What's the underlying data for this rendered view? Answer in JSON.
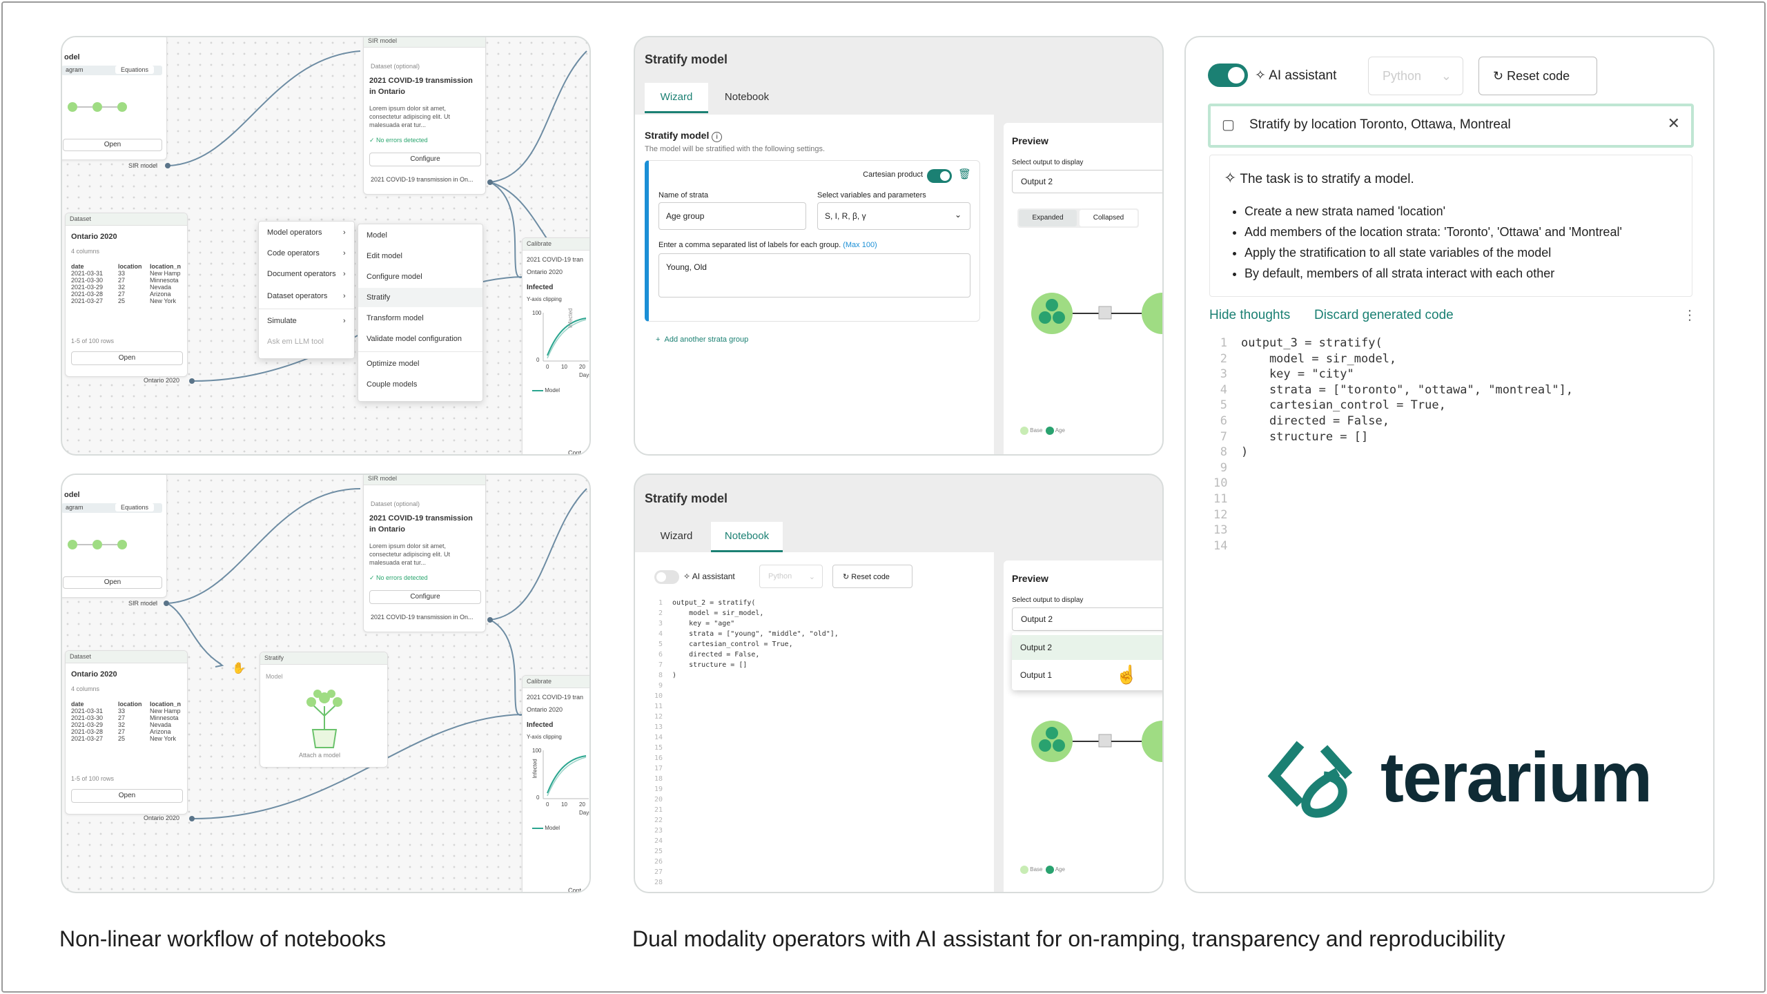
{
  "panel1": {
    "model_node": {
      "title": "odel",
      "tabs": [
        "agram",
        "Equations"
      ],
      "open": "Open",
      "port": "SIR model"
    },
    "sir_node": {
      "header": "SIR model",
      "dataset_opt": "Dataset (optional)",
      "title": "2021 COVID-19 transmission in Ontario",
      "body": "Lorem ipsum dolor sit amet, consectetur adipiscing elit. Ut malesuada erat tur...",
      "status": "No errors detected",
      "configure": "Configure",
      "port": "2021 COVID-19 transmission in On..."
    },
    "dataset_node": {
      "header": "Dataset",
      "title": "Ontario 2020",
      "columns": "4 columns",
      "table_headers": [
        "date",
        "location",
        "location_n"
      ],
      "rows": [
        [
          "2021-03-31",
          "33",
          "New Hamp"
        ],
        [
          "2021-03-30",
          "27",
          "Minnesota"
        ],
        [
          "2021-03-29",
          "32",
          "Nevada"
        ],
        [
          "2021-03-28",
          "27",
          "Arizona"
        ],
        [
          "2021-03-27",
          "25",
          "New York"
        ]
      ],
      "rows_info": "1-5 of 100 rows",
      "open": "Open",
      "port": "Ontario 2020"
    },
    "context_menu": [
      "Model operators",
      "Code operators",
      "Document operators",
      "Dataset operators",
      "Simulate",
      "Ask em LLM tool"
    ],
    "submenu": [
      "Model",
      "Edit model",
      "Configure model",
      "Stratify",
      "Transform model",
      "Validate model configuration",
      "Optimize model",
      "Couple models"
    ],
    "calibrate_node": {
      "header": "Calibrate",
      "in1": "2021 COVID-19 tran",
      "in2": "Ontario 2020",
      "var": "Infected",
      "clip": "Y-axis clipping",
      "ylabel": "Infected",
      "yticks": [
        "100",
        "0"
      ],
      "xticks": [
        "0",
        "10",
        "20"
      ],
      "xlabel": "Days",
      "legend": "Model",
      "out": "Cont"
    }
  },
  "panel2": {
    "title": "Stratify model",
    "tabs": [
      "Wizard",
      "Notebook"
    ],
    "section_title": "Stratify model",
    "section_sub": "The model will be stratified with the following settings.",
    "cartesian_label": "Cartesian product",
    "name_label": "Name of strata",
    "name_value": "Age group",
    "vars_label": "Select variables and parameters",
    "vars_value": "S, I, R, β, γ",
    "labels_label": "Enter a comma separated list of labels for each group.",
    "labels_max": "(Max 100)",
    "labels_value": "Young, Old",
    "add_group": "Add another strata group",
    "preview": {
      "title": "Preview",
      "select_label": "Select output to display",
      "selected": "Output 2",
      "tabs": [
        "Expanded",
        "Collapsed"
      ],
      "legend": [
        "Base",
        "Age"
      ]
    }
  },
  "panel3": {
    "model_node": {
      "title": "odel",
      "tabs": [
        "agram",
        "Equations"
      ],
      "open": "Open",
      "port": "SIR model"
    },
    "sir_node": {
      "header": "SIR model",
      "dataset_opt": "Dataset (optional)",
      "title": "2021 COVID-19 transmission in Ontario",
      "body": "Lorem ipsum dolor sit amet, consectetur adipiscing elit. Ut malesuada erat tur...",
      "status": "No errors detected",
      "configure": "Configure",
      "port": "2021 COVID-19 transmission in On..."
    },
    "dataset_node": {
      "header": "Dataset",
      "title": "Ontario 2020",
      "columns": "4 columns",
      "table_headers": [
        "date",
        "location",
        "location_n"
      ],
      "rows": [
        [
          "2021-03-31",
          "33",
          "New Hamp"
        ],
        [
          "2021-03-30",
          "27",
          "Minnesota"
        ],
        [
          "2021-03-29",
          "32",
          "Nevada"
        ],
        [
          "2021-03-28",
          "27",
          "Arizona"
        ],
        [
          "2021-03-27",
          "25",
          "New York"
        ]
      ],
      "rows_info": "1-5 of 100 rows",
      "open": "Open",
      "port": "Ontario 2020"
    },
    "stratify_node": {
      "header": "Stratify",
      "model": "Model",
      "attach": "Attach a model"
    },
    "calibrate_node": {
      "header": "Calibrate",
      "in1": "2021 COVID-19 tran",
      "in2": "Ontario 2020",
      "var": "Infected",
      "clip": "Y-axis clipping",
      "ylabel": "Infected",
      "yticks": [
        "100",
        "0"
      ],
      "xticks": [
        "0",
        "10",
        "20"
      ],
      "xlabel": "Days",
      "legend": "Model",
      "out": "Cont"
    }
  },
  "panel4": {
    "title": "Stratify model",
    "tabs": [
      "Wizard",
      "Notebook"
    ],
    "ai_label": "AI assistant",
    "lang": "Python",
    "reset": "Reset code",
    "code": [
      "output_2 = stratify(",
      "    model = sir_model,",
      "    key = \"age\"",
      "    strata = [\"young\", \"middle\", \"old\"],",
      "    cartesian_control = True,",
      "    directed = False,",
      "    structure = []",
      ")"
    ],
    "line_count": 28,
    "preview": {
      "title": "Preview",
      "select_label": "Select output to display",
      "selected": "Output 2",
      "options": [
        "Output 2",
        "Output 1"
      ],
      "legend": [
        "Base",
        "Age"
      ]
    }
  },
  "panel5": {
    "ai_label": "AI assistant",
    "lang": "Python",
    "reset": "Reset code",
    "prompt": "Stratify by location Toronto, Ottawa, Montreal",
    "thought_title": "The task is to stratify a model.",
    "bullets": [
      "Create a new strata named 'location'",
      "Add members of the location strata: 'Toronto', 'Ottawa' and 'Montreal'",
      "Apply the stratification to all state variables of the model",
      "By default, members of all strata interact with each other"
    ],
    "hide_thoughts": "Hide thoughts",
    "discard": "Discard generated code",
    "code": [
      "output_3 = stratify(",
      "    model = sir_model,",
      "    key = \"city\"",
      "    strata = [\"toronto\", \"ottawa\", \"montreal\"],",
      "    cartesian_control = True,",
      "    directed = False,",
      "    structure = []",
      ")"
    ],
    "line_count": 14,
    "logo_text": "terarium"
  },
  "captions": {
    "left": "Non-linear workflow of notebooks",
    "right": "Dual modality operators with AI assistant for on-ramping, transparency and reproducibility"
  },
  "colors": {
    "accent": "#1b8073",
    "brand_dark": "#0f2b35",
    "node_green": "#9fdc83"
  }
}
